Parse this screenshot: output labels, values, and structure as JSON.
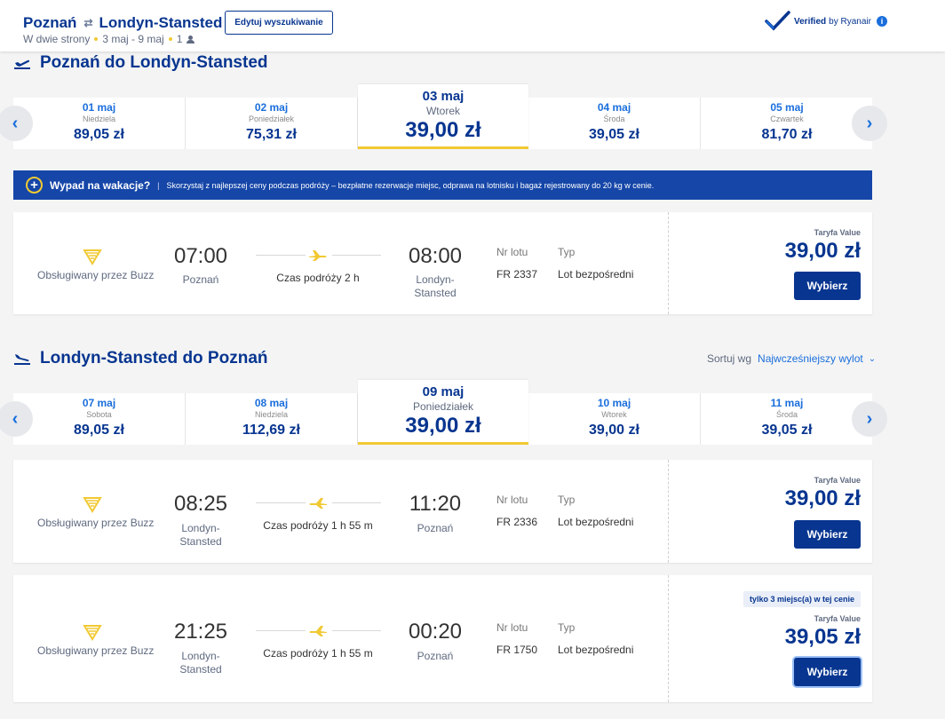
{
  "header": {
    "origin": "Poznań",
    "destination": "Londyn-Stansted",
    "trip_type": "W dwie strony",
    "dates": "3 maj - 9 maj",
    "passengers": "1",
    "edit_label": "Edytuj wyszukiwanie",
    "verified_label": "Verified",
    "verified_by": "by Ryanair",
    "info_glyph": "i"
  },
  "promo": {
    "title": "Wypad na wakacje?",
    "separator": "|",
    "text": "Skorzystaj z najlepszej ceny podczas podróży – bezpłatne rezerwacje miejsc, odprawa na lotnisku i bagaż rejestrowany do 20 kg w cenie."
  },
  "outbound": {
    "title": "Poznań do Londyn-Stansted",
    "dates": [
      {
        "date": "01 maj",
        "weekday": "Niedziela",
        "price": "89,05 zł"
      },
      {
        "date": "02 maj",
        "weekday": "Poniedziałek",
        "price": "75,31 zł"
      },
      {
        "date": "03 maj",
        "weekday": "Wtorek",
        "price": "39,00 zł"
      },
      {
        "date": "04 maj",
        "weekday": "Środa",
        "price": "39,05 zł"
      },
      {
        "date": "05 maj",
        "weekday": "Czwartek",
        "price": "81,70 zł"
      }
    ],
    "flights": [
      {
        "operator": "Obsługiwany przez Buzz",
        "dep_time": "07:00",
        "dep_city": "Poznań",
        "duration": "Czas podróży 2 h",
        "arr_time": "08:00",
        "arr_city": "Londyn-\nStansted",
        "flight_label": "Nr lotu",
        "flight_no": "FR 2337",
        "type_label": "Typ",
        "type": "Lot bezpośredni",
        "fare_label": "Taryfa Value",
        "price": "39,00 zł",
        "button": "Wybierz"
      }
    ]
  },
  "inbound": {
    "title": "Londyn-Stansted do Poznań",
    "sort_label": "Sortuj wg",
    "sort_value": "Najwcześniejszy wylot",
    "dates": [
      {
        "date": "07 maj",
        "weekday": "Sobota",
        "price": "89,05 zł"
      },
      {
        "date": "08 maj",
        "weekday": "Niedziela",
        "price": "112,69 zł"
      },
      {
        "date": "09 maj",
        "weekday": "Poniedziałek",
        "price": "39,00 zł"
      },
      {
        "date": "10 maj",
        "weekday": "Wtorek",
        "price": "39,00 zł"
      },
      {
        "date": "11 maj",
        "weekday": "Środa",
        "price": "39,05 zł"
      }
    ],
    "flights": [
      {
        "operator": "Obsługiwany przez Buzz",
        "dep_time": "08:25",
        "dep_city": "Londyn-\nStansted",
        "duration": "Czas podróży 1 h 55 m",
        "arr_time": "11:20",
        "arr_city": "Poznań",
        "flight_label": "Nr lotu",
        "flight_no": "FR 2336",
        "type_label": "Typ",
        "type": "Lot bezpośredni",
        "fare_label": "Taryfa Value",
        "price": "39,00 zł",
        "button": "Wybierz"
      },
      {
        "operator": "Obsługiwany przez Buzz",
        "dep_time": "21:25",
        "dep_city": "Londyn-\nStansted",
        "duration": "Czas podróży 1 h 55 m",
        "arr_time": "00:20",
        "arr_city": "Poznań",
        "flight_label": "Nr lotu",
        "flight_no": "FR 1750",
        "type_label": "Typ",
        "type": "Lot bezpośredni",
        "badge": "tylko 3 miejsc(a) w tej cenie",
        "fare_label": "Taryfa Value",
        "price": "39,05 zł",
        "button": "Wybierz"
      }
    ]
  },
  "colors": {
    "brand": "#073590",
    "accent": "#f1c933",
    "link": "#1a6edc",
    "promo_bg": "#1546a8"
  }
}
